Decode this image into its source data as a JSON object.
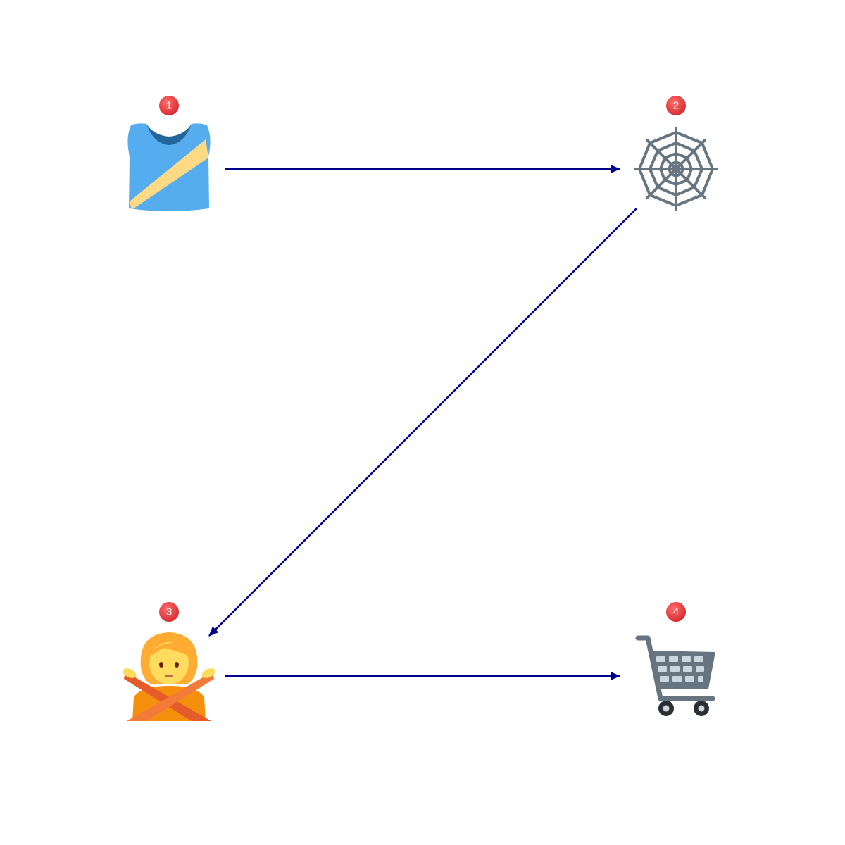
{
  "diagram": {
    "nodes": [
      {
        "id": "1",
        "label": "1",
        "icon": "tank-top-icon",
        "description_color": "#55acee"
      },
      {
        "id": "2",
        "label": "2",
        "icon": "spider-web-icon",
        "description_color": "#66757f"
      },
      {
        "id": "3",
        "label": "3",
        "icon": "person-gesturing-no-icon",
        "description_color": "#ffcc4d"
      },
      {
        "id": "4",
        "label": "4",
        "icon": "shopping-cart-icon",
        "description_color": "#66757f"
      }
    ],
    "edges": [
      {
        "from": "1",
        "to": "2"
      },
      {
        "from": "2",
        "to": "3"
      },
      {
        "from": "3",
        "to": "4"
      }
    ],
    "colors": {
      "arrow": "#00008b",
      "badge": "#e8363a",
      "badge_text": "#ffffff"
    }
  }
}
